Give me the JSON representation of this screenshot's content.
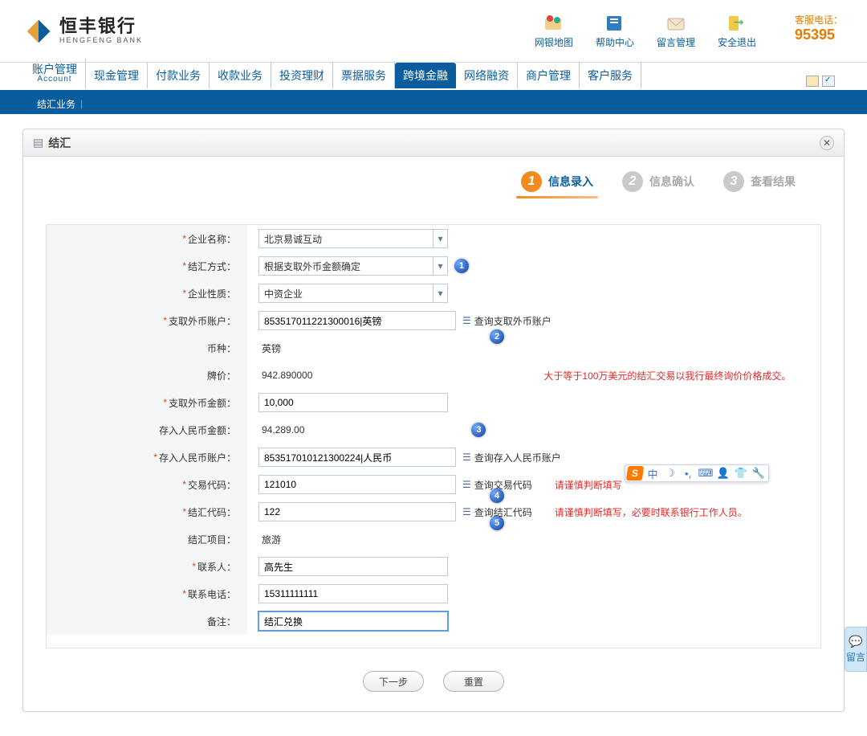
{
  "brand": {
    "cn": "恒丰银行",
    "en": "HENGFENG BANK"
  },
  "hotline": {
    "label": "客服电话：",
    "number": "95395"
  },
  "topIcons": [
    {
      "label": "网银地图",
      "key": "map"
    },
    {
      "label": "帮助中心",
      "key": "help"
    },
    {
      "label": "留言管理",
      "key": "msg"
    },
    {
      "label": "安全退出",
      "key": "logout"
    }
  ],
  "mainnav": {
    "first": {
      "cn": "账户管理",
      "en": "Account"
    },
    "items": [
      "现金管理",
      "付款业务",
      "收款业务",
      "投资理财",
      "票据服务",
      "跨境金融",
      "网络融资",
      "商户管理",
      "客户服务"
    ],
    "activeIndex": 5
  },
  "subnav": {
    "item": "结汇业务"
  },
  "panel": {
    "title": "结汇"
  },
  "steps": [
    {
      "num": "1",
      "label": "信息录入"
    },
    {
      "num": "2",
      "label": "信息确认"
    },
    {
      "num": "3",
      "label": "查看结果"
    }
  ],
  "form": {
    "labels": {
      "company": "企业名称：",
      "method": "结汇方式：",
      "nature": "企业性质：",
      "fxAccount": "支取外币账户：",
      "currency": "币种：",
      "rate": "牌价：",
      "fxAmount": "支取外币金额：",
      "rmbAmount": "存入人民币金额：",
      "rmbAccount": "存入人民币账户：",
      "txCode": "交易代码：",
      "jhCode": "结汇代码：",
      "jhItem": "结汇项目：",
      "contact": "联系人：",
      "phone": "联系电话：",
      "remark": "备注："
    },
    "values": {
      "company": "北京易诚互动",
      "method": "根据支取外币金额确定",
      "nature": "中资企业",
      "fxAccount": "853517011221300016|英镑",
      "currency": "英镑",
      "rate": "942.890000",
      "fxAmount": "10,000",
      "rmbAmount": "94,289.00",
      "rmbAccount": "853517010121300224|人民币",
      "txCode": "121010",
      "jhCode": "122",
      "jhItem": "旅游",
      "contact": "高先生",
      "phone": "15311111111",
      "remark": "结汇兑换"
    },
    "lookups": {
      "fxAccount": "查询支取外币账户",
      "rmbAccount": "查询存入人民币账户",
      "txCode": "查询交易代码",
      "jhCode": "查询结汇代码"
    },
    "hints": {
      "rate": "大于等于100万美元的结汇交易以我行最终询价价格成交。",
      "txCode": "请谨慎判断填写",
      "jhCode": "请谨慎判断填写，必要时联系银行工作人员。"
    }
  },
  "buttons": {
    "next": "下一步",
    "reset": "重置"
  },
  "ime": {
    "zhong": "中"
  },
  "sideFeedback": "留言",
  "annotations": [
    "1",
    "2",
    "3",
    "4",
    "5"
  ]
}
